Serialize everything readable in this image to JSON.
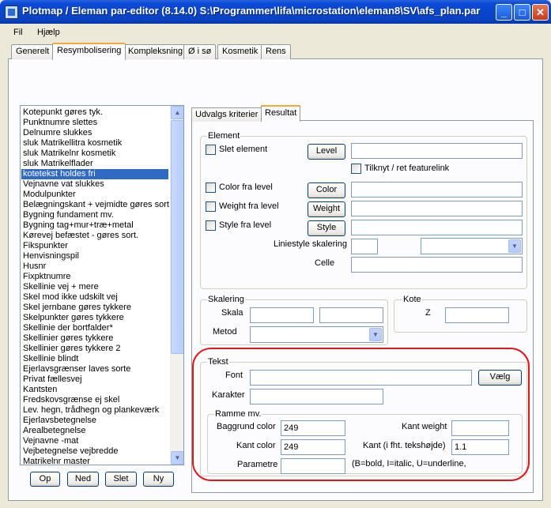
{
  "window": {
    "title": "Plotmap / Eleman par-editor (8.14.0) S:\\Programmer\\lifa\\microstation\\eleman8\\SV\\afs_plan.par",
    "minimize_label": "_",
    "maximize_label": "□",
    "close_label": "✕"
  },
  "menu": {
    "fil": "Fil",
    "hjaelp": "Hjælp"
  },
  "tabs": [
    "Generelt",
    "Resymbolisering",
    "Kompleksning",
    "Ø i sø",
    "Kosmetik",
    "Rens"
  ],
  "list": {
    "items": [
      "Kotepunkt gøres tyk.",
      "Punktnumre slettes",
      "Delnumre slukkes",
      "sluk Matrikellitra kosmetik",
      "sluk Matrikelnr kosmetik",
      "sluk Matrikelflader",
      "kotetekst holdes fri",
      "Vejnavne vat slukkes",
      "Modulpunkter",
      "Belægningskant + vejmidte gøres sort,",
      "Bygning fundament mv.",
      "Bygning tag+mur+træ+metal",
      "Kørevej befæstet - gøres sort.",
      "Fikspunkter",
      "Henvisningspil",
      "Husnr",
      "Fixpktnumre",
      "Skellinie vej + mere",
      "Skel mod ikke udskilt vej",
      "Skel jernbane gøres tykkere",
      "Skelpunkter gøres tykkere",
      "Skellinie der bortfalder*",
      "Skellinier gøres tykkere",
      "Skellinier gøres tykkere 2",
      "Skellinie blindt",
      "Ejerlavsgrænser laves sorte",
      "Privat fællesvej",
      "Kantsten",
      "Fredskovsgrænse ej skel",
      "Lev. hegn, trådhegn og plankeværk",
      "Ejerlavsbetegnelse",
      "Arealbetegnelse",
      "Vejnavne -mat",
      "Vejbetegnelse vejbredde",
      "Matrikelnr master"
    ],
    "selected_index": 6,
    "buttons": {
      "op": "Op",
      "ned": "Ned",
      "slet": "Slet",
      "ny": "Ny"
    }
  },
  "inner_tabs": [
    "Udvalgs kriterier",
    "Resultat"
  ],
  "element": {
    "group_label": "Element",
    "slet_element": "Slet element",
    "level_button": "Level",
    "tilknyt": "Tilknyt / ret featurelink",
    "color_fra_level": "Color fra level",
    "color_button": "Color",
    "weight_fra_level": "Weight fra level",
    "weight_button": "Weight",
    "style_fra_level": "Style fra level",
    "style_button": "Style",
    "liniestyle_skalering": "Liniestyle skalering",
    "celle": "Celle"
  },
  "skalering": {
    "group_label": "Skalering",
    "skala": "Skala",
    "metod": "Metod"
  },
  "kote": {
    "group_label": "Kote",
    "z": "Z"
  },
  "tekst": {
    "group_label": "Tekst",
    "font": "Font",
    "vaelg_button": "Vælg",
    "karakter": "Karakter"
  },
  "ramme": {
    "group_label": "Ramme mv.",
    "baggrund_color": "Baggrund color",
    "baggrund_color_value": "249",
    "kant_weight": "Kant weight",
    "kant_color": "Kant color",
    "kant_color_value": "249",
    "kant_teksthojde": "Kant (i fht. tekshøjde)",
    "kant_teksthojde_value": "1.1",
    "parametre": "Parametre",
    "parametre_hint": "(B=bold, I=italic, U=underline,"
  },
  "colors": {
    "highlight": "#e2161b",
    "selection": "#316ac5",
    "tab_accent": "#f5a93b"
  }
}
